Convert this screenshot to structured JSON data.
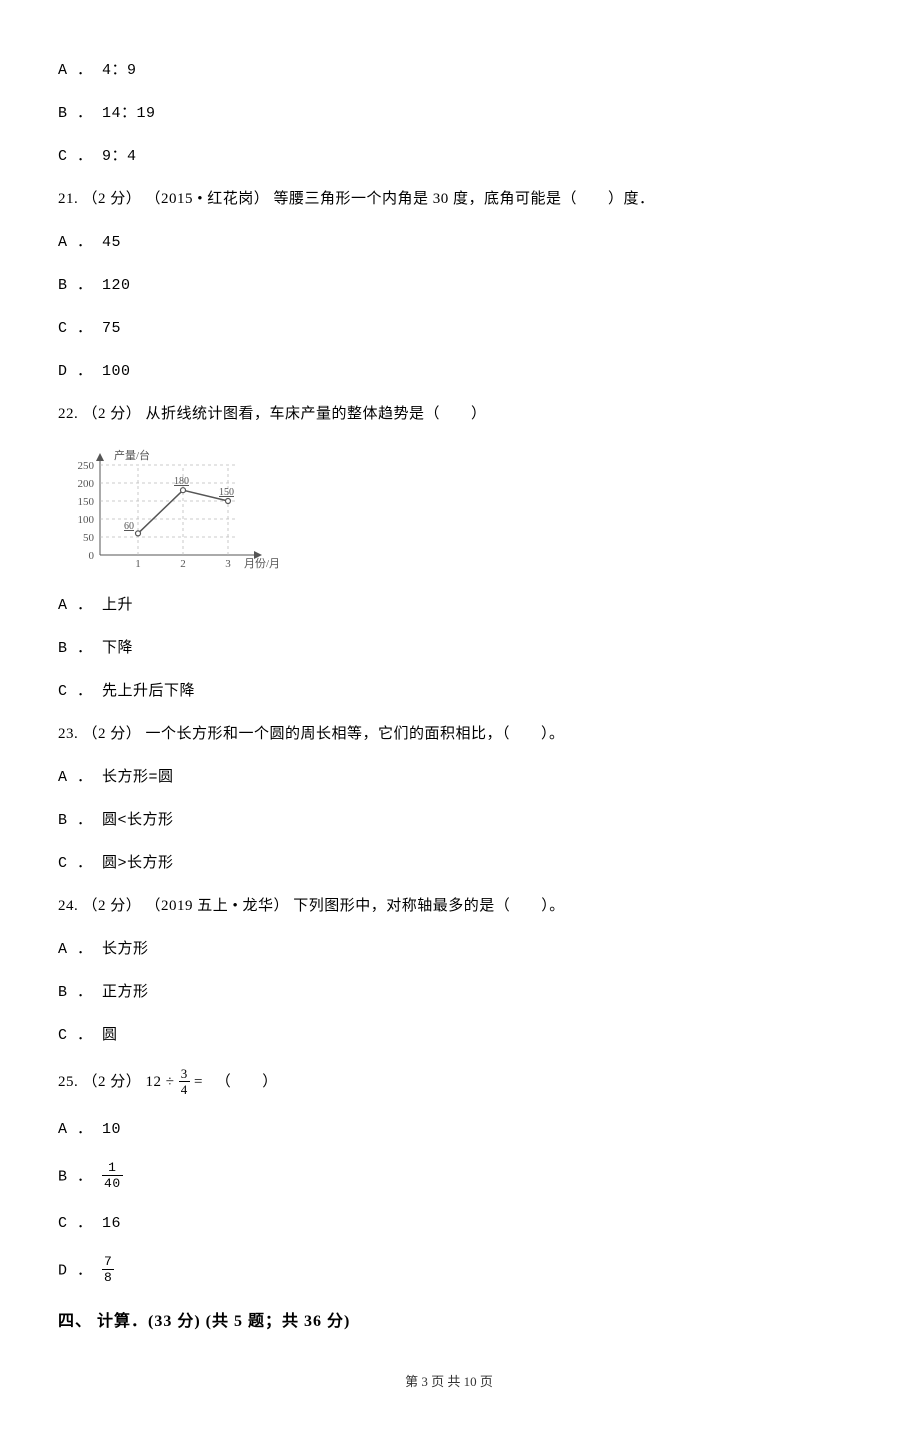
{
  "q20": {
    "A": "A ． 4：9",
    "B": "B ． 14：19",
    "C": "C ． 9：4"
  },
  "q21": {
    "stem": "21. （2 分） （2015 • 红花岗） 等腰三角形一个内角是 30 度，底角可能是（　　）度．",
    "A": "A ． 45",
    "B": "B ． 120",
    "C": "C ． 75",
    "D": "D ． 100"
  },
  "q22": {
    "stem": "22. （2 分） 从折线统计图看，车床产量的整体趋势是（　　）",
    "A": "A ． 上升",
    "B": "B ． 下降",
    "C": "C ． 先上升后下降"
  },
  "q23": {
    "stem": "23. （2 分） 一个长方形和一个圆的周长相等，它们的面积相比，（　　）。",
    "A": "A ． 长方形=圆",
    "B": "B ． 圆<长方形",
    "C": "C ． 圆>长方形"
  },
  "q24": {
    "stem": "24. （2 分） （2019 五上 • 龙华） 下列图形中，对称轴最多的是（　　）。",
    "A": "A ． 长方形",
    "B": "B ． 正方形",
    "C": "C ． 圆"
  },
  "q25": {
    "stem_prefix": "25. （2 分）",
    "expr_lhs": "12 ÷",
    "expr_frac_num": "3",
    "expr_frac_den": "4",
    "expr_eq": "=",
    "stem_suffix": "（　　）",
    "A": "A ． 10",
    "B_prefix": "B ．",
    "B_frac_num": "1",
    "B_frac_den": "40",
    "C": "C ． 16",
    "D_prefix": "D ．",
    "D_frac_num": "7",
    "D_frac_den": "8"
  },
  "section4": "四、 计算．(33 分)  (共 5 题；共 36 分)",
  "footer": "第 3 页 共 10 页",
  "chart_data": {
    "type": "line",
    "title": "",
    "xlabel": "月份/月",
    "ylabel": "产量/台",
    "categories": [
      "1",
      "2",
      "3"
    ],
    "values": [
      60,
      180,
      150
    ],
    "ylim": [
      0,
      250
    ],
    "yticks": [
      0,
      50,
      100,
      150,
      200,
      250
    ]
  },
  "chart_labels": {
    "y250": "250",
    "y200": "200",
    "y150": "150",
    "y100": "100",
    "y50": "50",
    "y0": "0",
    "x1": "1",
    "x2": "2",
    "x3": "3",
    "xaxis": "月份/月",
    "yaxis": "产量/台",
    "p60": "60",
    "p180": "180",
    "p150": "150"
  }
}
